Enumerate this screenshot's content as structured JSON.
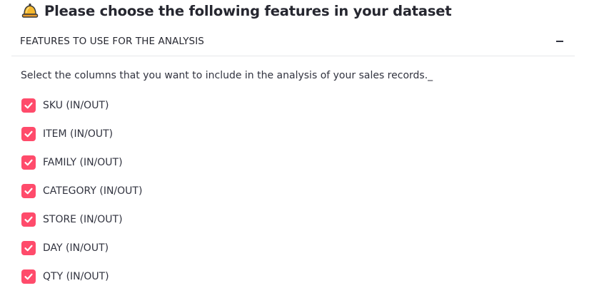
{
  "header": {
    "icon": "bell-icon",
    "title": "Please choose the following features in your dataset"
  },
  "expander": {
    "title": "FEATURES TO USE FOR THE ANALYSIS",
    "collapse_icon": "minus-icon",
    "expanded": true
  },
  "description": "Select the columns that you want to include in the analysis of your sales records._",
  "checkboxes": [
    {
      "label": "SKU (IN/OUT)",
      "checked": true
    },
    {
      "label": "ITEM (IN/OUT)",
      "checked": true
    },
    {
      "label": "FAMILY (IN/OUT)",
      "checked": true
    },
    {
      "label": "CATEGORY (IN/OUT)",
      "checked": true
    },
    {
      "label": "STORE (IN/OUT)",
      "checked": true
    },
    {
      "label": "DAY (IN/OUT)",
      "checked": true
    },
    {
      "label": "QTY (IN/OUT)",
      "checked": true
    }
  ],
  "colors": {
    "checkbox_checked": "#ff4b6b",
    "text": "#31333f",
    "divider": "#e6e7ea"
  }
}
